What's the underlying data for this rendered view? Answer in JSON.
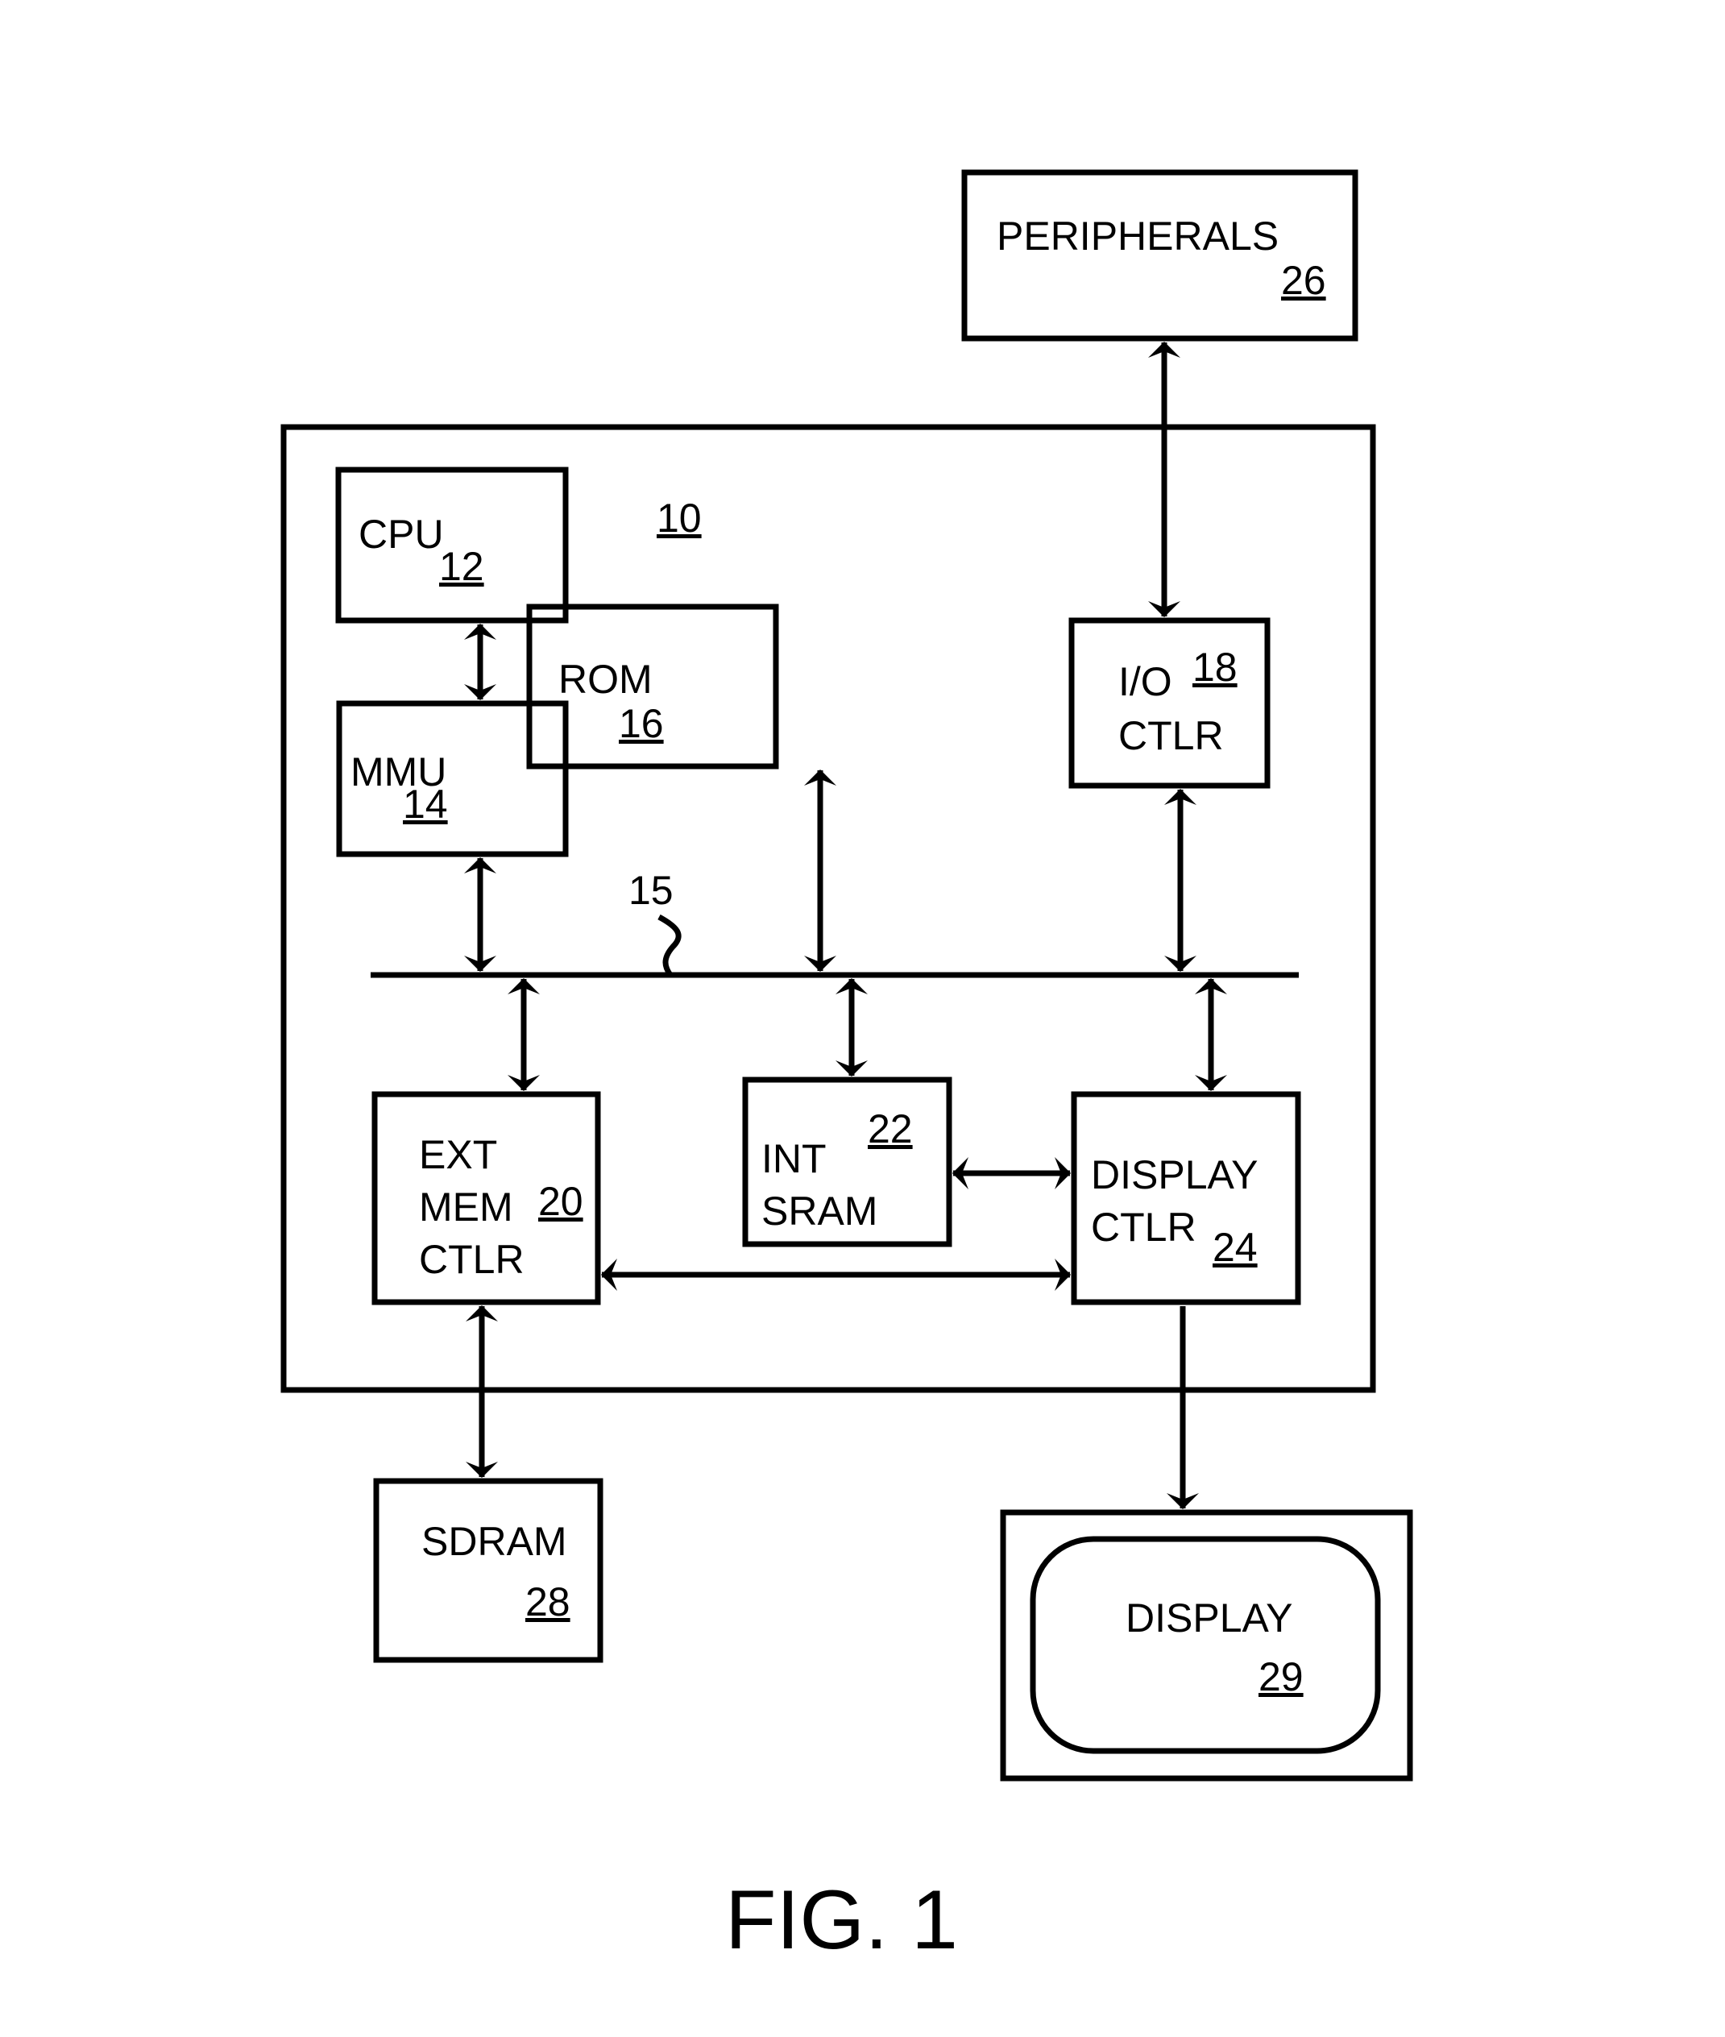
{
  "figure": {
    "caption": "FIG. 1",
    "chip_ref": "10",
    "bus_ref": "15"
  },
  "blocks": {
    "peripherals": {
      "label": [
        "PERIPHERALS"
      ],
      "ref": "26"
    },
    "cpu": {
      "label": [
        "CPU"
      ],
      "ref": "12"
    },
    "mmu": {
      "label": [
        "MMU"
      ],
      "ref": "14"
    },
    "rom": {
      "label": [
        "ROM"
      ],
      "ref": "16"
    },
    "io_ctlr": {
      "label": [
        "I/O",
        "CTLR"
      ],
      "ref": "18"
    },
    "ext_mem_ctlr": {
      "label": [
        "EXT",
        "MEM",
        "CTLR"
      ],
      "ref": "20"
    },
    "int_sram": {
      "label": [
        "INT",
        "SRAM"
      ],
      "ref": "22"
    },
    "display_ctlr": {
      "label": [
        "DISPLAY",
        "CTLR"
      ],
      "ref": "24"
    },
    "sdram": {
      "label": [
        "SDRAM"
      ],
      "ref": "28"
    },
    "display": {
      "label": [
        "DISPLAY"
      ],
      "ref": "29"
    }
  },
  "connections": [
    {
      "from": "peripherals",
      "to": "io_ctlr",
      "type": "bidirectional"
    },
    {
      "from": "cpu",
      "to": "mmu",
      "type": "bidirectional"
    },
    {
      "from": "mmu",
      "to": "bus",
      "type": "bidirectional"
    },
    {
      "from": "rom",
      "to": "bus",
      "type": "bidirectional"
    },
    {
      "from": "io_ctlr",
      "to": "bus",
      "type": "bidirectional"
    },
    {
      "from": "bus",
      "to": "ext_mem_ctlr",
      "type": "bidirectional"
    },
    {
      "from": "bus",
      "to": "int_sram",
      "type": "bidirectional"
    },
    {
      "from": "bus",
      "to": "display_ctlr",
      "type": "bidirectional"
    },
    {
      "from": "int_sram",
      "to": "display_ctlr",
      "type": "bidirectional"
    },
    {
      "from": "ext_mem_ctlr",
      "to": "display_ctlr",
      "type": "bidirectional"
    },
    {
      "from": "ext_mem_ctlr",
      "to": "sdram",
      "type": "bidirectional"
    },
    {
      "from": "display_ctlr",
      "to": "display",
      "type": "unidirectional"
    }
  ]
}
